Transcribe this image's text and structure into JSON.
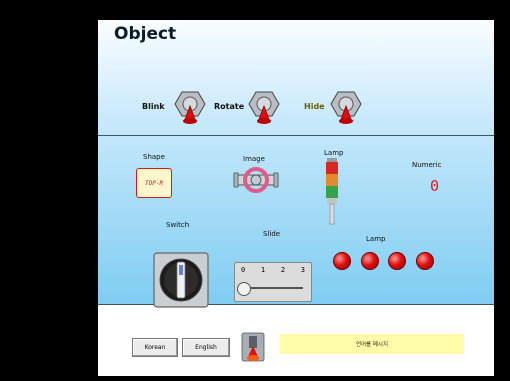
{
  "title": "Object",
  "toggles": {
    "blink_label": "Blink",
    "rotate_label": "Rotate",
    "hide_label": "Hide"
  },
  "labels": {
    "shape": "Shape",
    "image": "Image",
    "lamp_tower": "Lamp",
    "numeric": "Numeric",
    "switch": "Switch",
    "slide": "Slide",
    "lamp_row": "Lamp"
  },
  "shape_text": "TOP-R",
  "numeric_value": "0",
  "slide_ticks": [
    "0",
    "1",
    "2",
    "3"
  ],
  "slide_value": 0,
  "buttons": {
    "korean": "Korean",
    "english": "English"
  },
  "message": "언어를 메시지",
  "colors": {
    "lamp_red": "#e01010",
    "numeric_red": "#e21d1d",
    "message_bg": "#fffba8"
  }
}
